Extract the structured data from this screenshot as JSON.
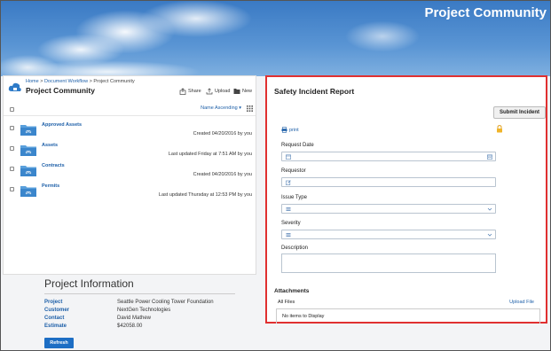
{
  "header": {
    "title": "Project Community"
  },
  "workspace": {
    "breadcrumb": {
      "home": "Home",
      "sep1": ">",
      "workflow": "Document Workflow",
      "sep2": ">",
      "current": "Project Community"
    },
    "title": "Project Community",
    "toolbar": {
      "share": "Share",
      "upload": "Upload",
      "new": "New"
    },
    "sort_label": "Name Ascending",
    "folders": [
      {
        "name": "Approved Assets",
        "meta": "Created 04/20/2016 by you"
      },
      {
        "name": "Assets",
        "meta": "Last updated Friday at 7:51 AM by you"
      },
      {
        "name": "Contracts",
        "meta": "Created 04/20/2016 by you"
      },
      {
        "name": "Permits",
        "meta": "Last updated Thursday at 12:53 PM by you"
      }
    ]
  },
  "project_info": {
    "title": "Project Information",
    "rows": [
      {
        "label": "Project",
        "value": "Seattle Power Cooling Tower Foundation"
      },
      {
        "label": "Customer",
        "value": "NextGen Technologies"
      },
      {
        "label": "Contact",
        "value": "David Mathew"
      },
      {
        "label": "Estimate",
        "value": "$42058.00"
      }
    ],
    "refresh_label": "Refresh"
  },
  "form": {
    "title": "Safety Incident Report",
    "submit_label": "Submit Incident",
    "print_label": "print",
    "fields": {
      "request_date": "Request Date",
      "requestor": "Requestor",
      "issue_type": "Issue Type",
      "severity": "Severity",
      "description": "Description"
    },
    "attachments": {
      "title": "Attachments",
      "all_files": "All Files",
      "upload_label": "Upload File",
      "empty": "No items to Display"
    }
  },
  "colors": {
    "accent": "#1d5fa8",
    "highlight_border": "#e03030",
    "button_blue": "#1d6ec4"
  }
}
